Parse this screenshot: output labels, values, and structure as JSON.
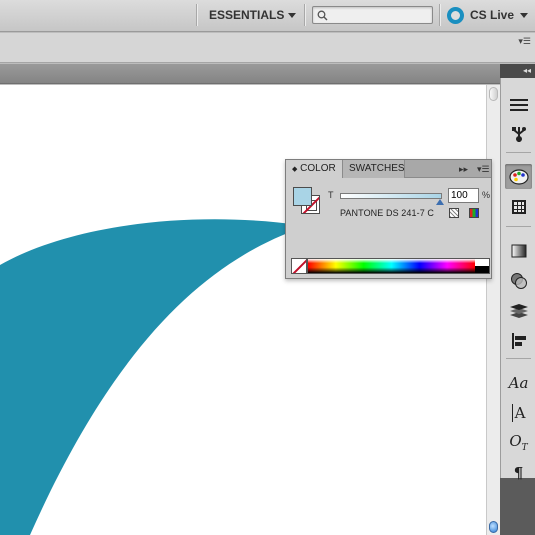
{
  "app_bar": {
    "workspace_label": "ESSENTIALS",
    "search": {
      "value": "",
      "placeholder": ""
    },
    "cs_live_label": "CS Live"
  },
  "secondary_bar": {
    "menu_glyph": "▾☰"
  },
  "dock": {
    "collapse_glyph": "◂◂",
    "tools": [
      {
        "name": "align-panel-icon"
      },
      {
        "name": "links-panel-icon"
      },
      {
        "name": "color-panel-icon",
        "active": true
      },
      {
        "name": "swatches-panel-icon"
      },
      {
        "name": "gradient-panel-icon"
      },
      {
        "name": "transparency-panel-icon"
      },
      {
        "name": "layers-panel-icon"
      },
      {
        "name": "align-objects-icon"
      },
      {
        "name": "character-styles-icon",
        "text": "Aa"
      },
      {
        "name": "character-panel-icon",
        "text": "A"
      },
      {
        "name": "opentype-panel-icon",
        "text": "O"
      },
      {
        "name": "paragraph-panel-icon",
        "text": "¶"
      }
    ]
  },
  "color_panel": {
    "tabs": [
      {
        "label": "COLOR",
        "active": true
      },
      {
        "label": "SWATCHES",
        "active": false
      }
    ],
    "tab_arrow": "◆",
    "expand_glyph": "▸▸",
    "menu_glyph": "▾☰",
    "tint_label": "T",
    "tint_value": "100",
    "tint_level": 1.0,
    "percent_label": "%",
    "swatch_name": "PANTONE DS 241-7 C",
    "fill_color": "#a9d4e6"
  },
  "canvas": {
    "shape_color": "#2190ad"
  }
}
